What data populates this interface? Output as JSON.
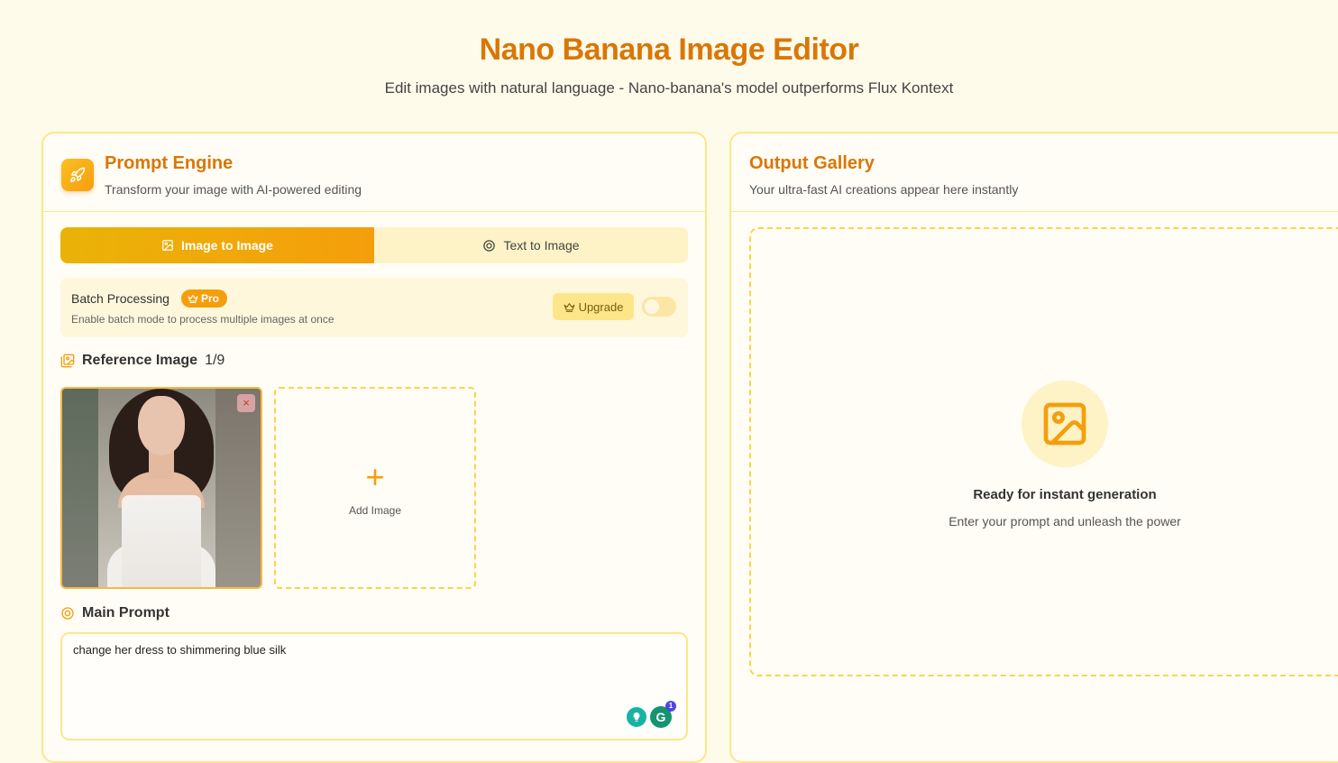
{
  "header": {
    "title": "Nano Banana Image Editor",
    "subtitle": "Edit images with natural language - Nano-banana's model outperforms Flux Kontext"
  },
  "prompt_engine": {
    "title": "Prompt Engine",
    "description": "Transform your image with AI-powered editing",
    "tabs": [
      {
        "label": "Image to Image",
        "active": true
      },
      {
        "label": "Text to Image",
        "active": false
      }
    ],
    "batch": {
      "label": "Batch Processing",
      "badge": "Pro",
      "description": "Enable batch mode to process multiple images at once",
      "upgrade_label": "Upgrade",
      "enabled": false
    },
    "reference": {
      "label": "Reference Image",
      "count": "1/9",
      "remove_glyph": "×",
      "add_label": "Add Image"
    },
    "main_prompt": {
      "label": "Main Prompt",
      "value": "change her dress to shimmering blue silk"
    },
    "extensions": {
      "grammarly_letter": "G",
      "grammarly_count": "1"
    }
  },
  "output_gallery": {
    "title": "Output Gallery",
    "description": "Your ultra-fast AI creations appear here instantly",
    "empty_title": "Ready for instant generation",
    "empty_description": "Enter your prompt and unleash the power"
  },
  "colors": {
    "accent": "#d97706",
    "accent_light": "#f59e0b",
    "background": "#fffbeb",
    "border": "#fde68a"
  }
}
